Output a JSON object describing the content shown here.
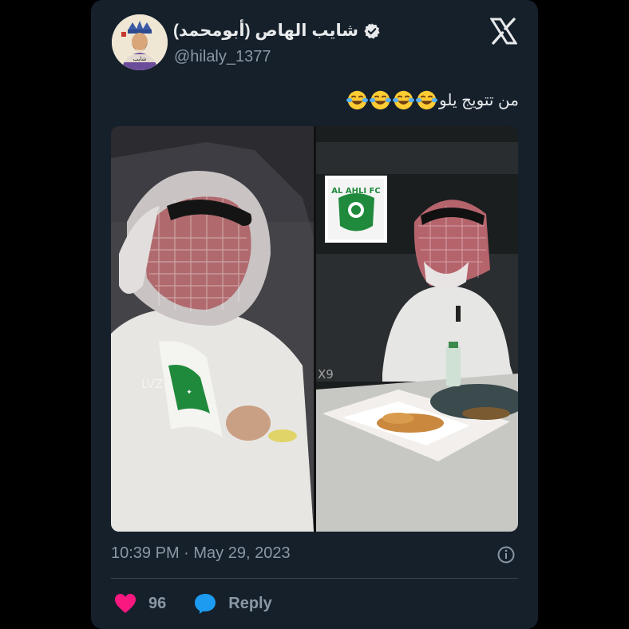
{
  "tweet": {
    "display_name": "شايب الهاص (أبومحمد)",
    "handle": "@hilaly_1377",
    "verified": true,
    "text": "من تتويج يلو",
    "emoji": [
      "face-with-tears-of-joy",
      "face-with-tears-of-joy",
      "face-with-tears-of-joy",
      "face-with-tears-of-joy"
    ],
    "timestamp": "10:39 PM · May 29, 2023",
    "likes": "96",
    "reply_label": "Reply",
    "platform_logo": "x-logo-icon"
  },
  "media": {
    "left_watermark": "LVZ",
    "right_watermark": "X9",
    "badge_text": "AL AHLI FC"
  },
  "colors": {
    "background": "#000000",
    "card": "#15202b",
    "text_primary": "#e7e9ea",
    "text_secondary": "#8b98a5",
    "like": "#f91880",
    "reply": "#1d9bf0",
    "ahli_green": "#1f8a3c"
  }
}
